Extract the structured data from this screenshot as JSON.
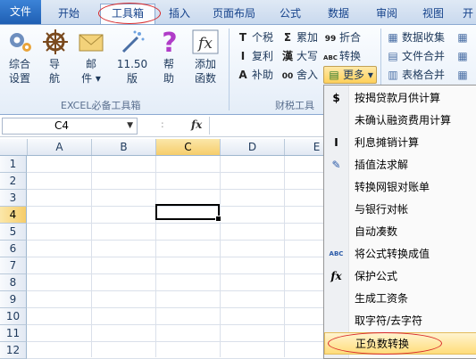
{
  "tabs": [
    "文件",
    "开始",
    "工具箱",
    "插入",
    "页面布局",
    "公式",
    "数据",
    "审阅",
    "视图",
    "开"
  ],
  "ribbon": {
    "group1": {
      "buttons": [
        {
          "label1": "综合",
          "label2": "设置",
          "icon": "gear-icon"
        },
        {
          "label1": "导",
          "label2": "航",
          "icon": "helm-icon"
        },
        {
          "label1": "邮",
          "label2": "件 ▾",
          "icon": "mail-icon"
        },
        {
          "label1": "11.50",
          "label2": "版",
          "icon": "wand-icon"
        },
        {
          "label1": "帮",
          "label2": "助",
          "icon": "help-icon"
        },
        {
          "label1": "添加",
          "label2": "函数",
          "icon": "fx-icon"
        }
      ],
      "title": "EXCEL必备工具箱"
    },
    "group2": {
      "items": [
        {
          "glyph": "T",
          "label": "个税"
        },
        {
          "glyph": "Σ",
          "label": "累加"
        },
        {
          "glyph": "99",
          "label": "折合"
        },
        {
          "glyph": "I",
          "label": "复利"
        },
        {
          "glyph": "漢",
          "label": "大写"
        },
        {
          "glyph": "ABC",
          "label": "转换"
        },
        {
          "glyph": "A",
          "label": "补助"
        },
        {
          "glyph": "00",
          "label": "舍入"
        },
        {
          "glyph": "▤",
          "label": "更多 ▾"
        }
      ],
      "title": "财税工具"
    },
    "group3": {
      "items": [
        "数据收集",
        "文件合并",
        "表格合并"
      ]
    }
  },
  "formula_bar": {
    "namebox": "C4",
    "fx": "fx"
  },
  "columns": [
    "A",
    "B",
    "C",
    "D",
    "E"
  ],
  "rows": [
    "1",
    "2",
    "3",
    "4",
    "5",
    "6",
    "7",
    "8",
    "9",
    "10",
    "11",
    "12"
  ],
  "selected_cell": "C4",
  "menu": {
    "items": [
      {
        "icon": "$",
        "label": "按揭贷款月供计算"
      },
      {
        "icon": "",
        "label": "未确认融资费用计算"
      },
      {
        "icon": "I",
        "label": "利息摊销计算"
      },
      {
        "icon": "✎",
        "label": "插值法求解"
      },
      {
        "icon": "",
        "label": "转换网银对账单"
      },
      {
        "icon": "",
        "label": "与银行对帐"
      },
      {
        "icon": "",
        "label": "自动凑数"
      },
      {
        "icon": "ABC",
        "label": "将公式转换成值"
      },
      {
        "icon": "fx",
        "label": "保护公式"
      },
      {
        "icon": "",
        "label": "生成工资条"
      },
      {
        "icon": "",
        "label": "取字符/去字符"
      },
      {
        "icon": "",
        "label": "正负数转换"
      }
    ]
  },
  "colors": {
    "accent": "#1f5fb3",
    "highlight": "#ffdd7a",
    "annotation": "#d8282a"
  }
}
